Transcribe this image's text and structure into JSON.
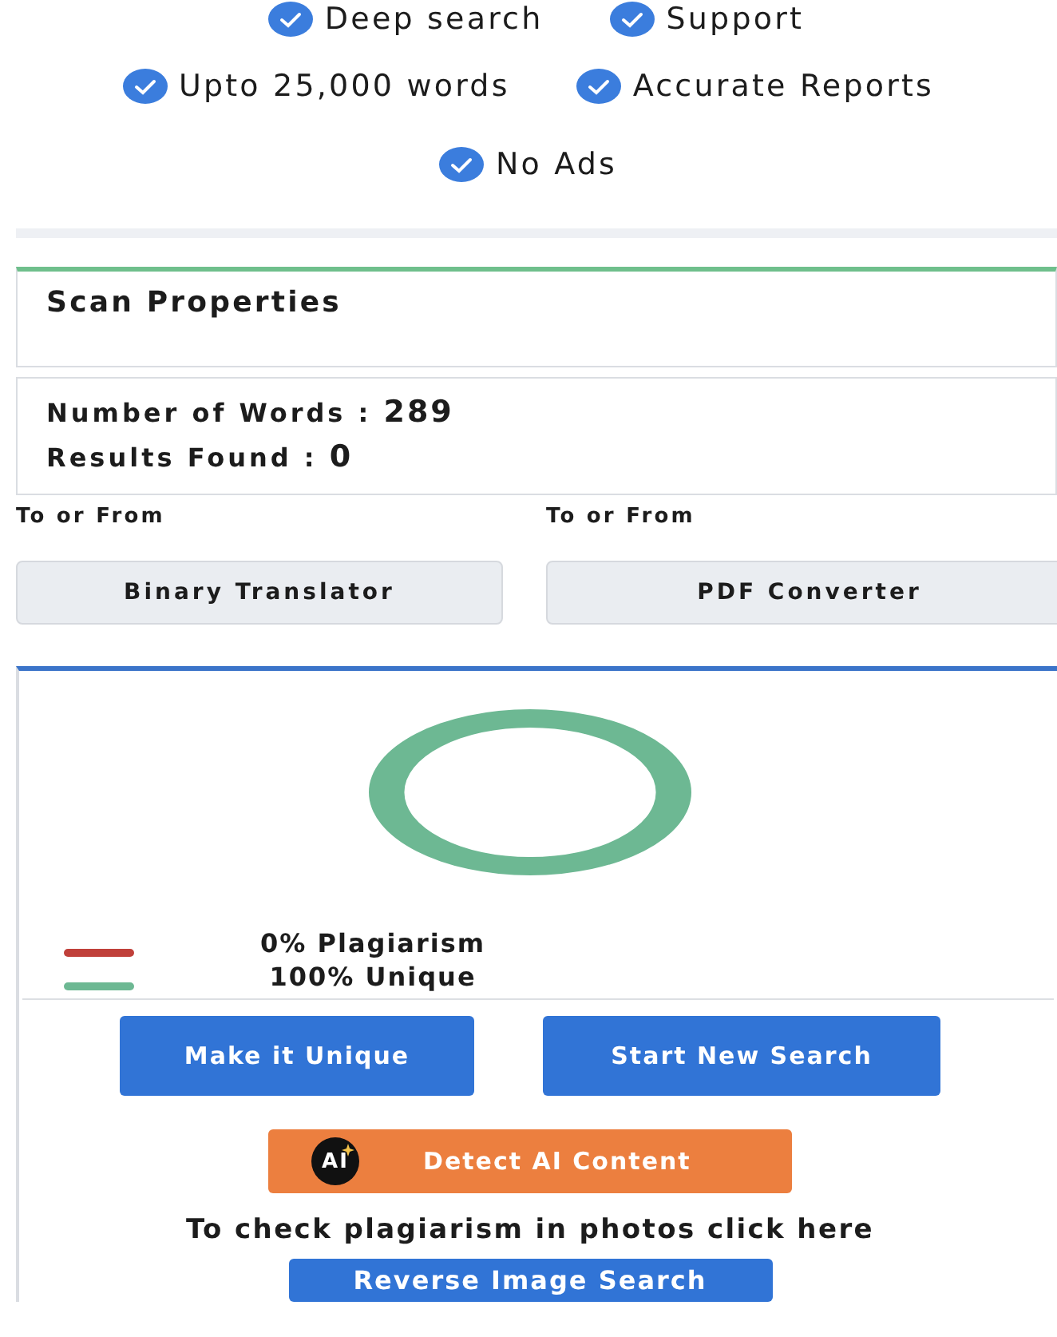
{
  "features": [
    {
      "label": "Deep search",
      "checked": true
    },
    {
      "label": "Support",
      "checked": true
    },
    {
      "label": "Upto 25,000 words",
      "checked": true
    },
    {
      "label": "Accurate Reports",
      "checked": true
    },
    {
      "label": "No Ads",
      "checked": true
    }
  ],
  "scan_properties": {
    "title": "Scan Properties",
    "stats": [
      {
        "label": "Number of Words : ",
        "value": "289"
      },
      {
        "label": "Results Found : ",
        "value": "0"
      }
    ]
  },
  "tools": [
    {
      "caption": "To or From",
      "button": "Binary Translator"
    },
    {
      "caption": "To or From",
      "button": "PDF Converter"
    }
  ],
  "result": {
    "legend": [
      {
        "label": "0% Plagiarism",
        "color": "#c0403a"
      },
      {
        "label": "100% Unique",
        "color": "#6db893"
      }
    ]
  },
  "actions": [
    "Make it Unique",
    "Start New Search"
  ],
  "detect_button": {
    "badge": "AI",
    "label": "Detect AI Content"
  },
  "photo_hint": "To check plagiarism in photos click here",
  "reverse_button": "Reverse Image Search"
}
